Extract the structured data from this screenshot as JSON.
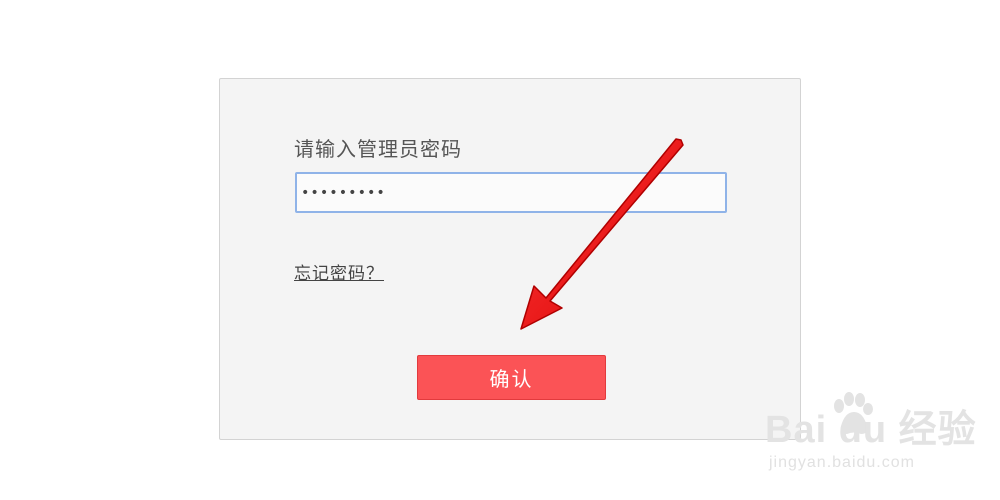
{
  "login": {
    "prompt": "请输入管理员密码",
    "password_value": "•••••••••",
    "forgot_link": "忘记密码？",
    "confirm_button": "确认"
  },
  "annotation": {
    "arrow_color": "#ee1111"
  },
  "watermark": {
    "logo_text": "Bai  du 经验",
    "url": "jingyan.baidu.com"
  },
  "colors": {
    "panel_bg": "#f4f4f4",
    "button_bg": "#fb5356",
    "input_border": "#8fb3e8"
  }
}
